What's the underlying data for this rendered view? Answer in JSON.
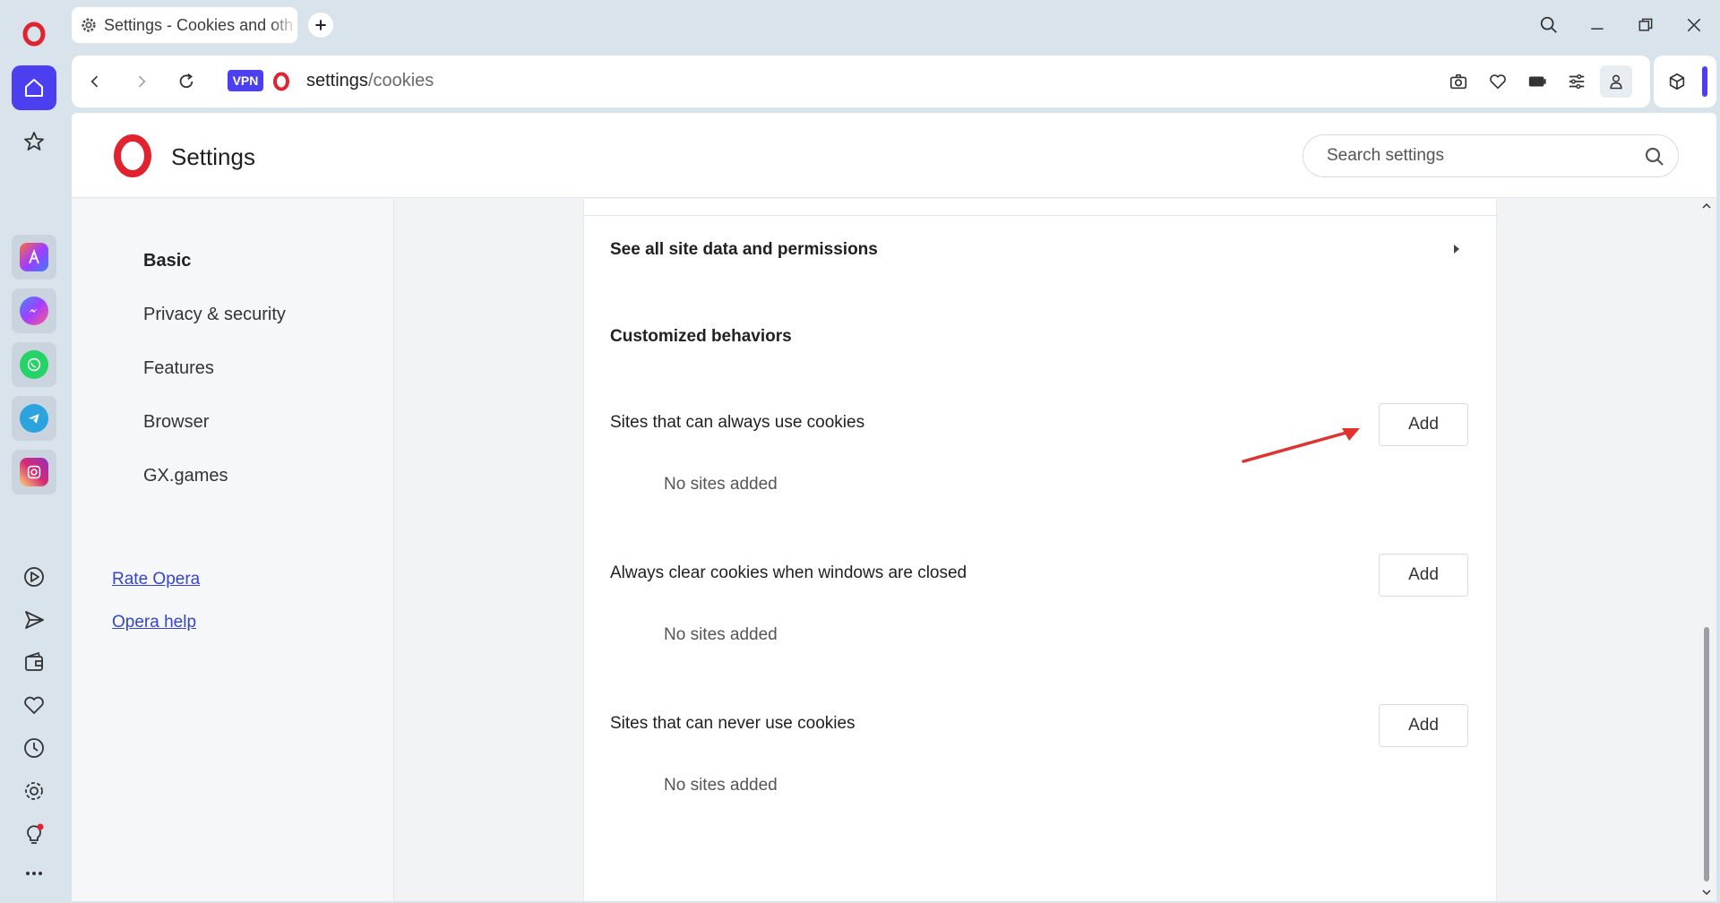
{
  "tab": {
    "title": "Settings - Cookies and other site data"
  },
  "address": {
    "vpn_label": "VPN",
    "url_host": "settings",
    "url_path": "/cookies"
  },
  "header": {
    "title": "Settings",
    "search_placeholder": "Search settings"
  },
  "nav": {
    "items": [
      {
        "label": "Basic",
        "active": true
      },
      {
        "label": "Privacy & security"
      },
      {
        "label": "Features"
      },
      {
        "label": "Browser"
      },
      {
        "label": "GX.games"
      }
    ],
    "links": [
      {
        "label": "Rate Opera"
      },
      {
        "label": "Opera help"
      }
    ]
  },
  "main": {
    "see_all": "See all site data and permissions",
    "customized_heading": "Customized behaviors",
    "sections": [
      {
        "title": "Sites that can always use cookies",
        "button": "Add",
        "empty": "No sites added"
      },
      {
        "title": "Always clear cookies when windows are closed",
        "button": "Add",
        "empty": "No sites added"
      },
      {
        "title": "Sites that can never use cookies",
        "button": "Add",
        "empty": "No sites added"
      }
    ]
  },
  "colors": {
    "accent": "#4b3ff0",
    "opera_red": "#e0232e",
    "annotation_arrow": "#e0322e"
  },
  "icons": {
    "sidebar": [
      "opera-logo-icon",
      "home-icon",
      "star-icon",
      "aria-icon",
      "messenger-icon",
      "whatsapp-icon",
      "telegram-icon",
      "instagram-icon",
      "player-icon",
      "send-icon",
      "wallet-icon",
      "heart-icon",
      "history-icon",
      "gear-icon",
      "lightbulb-icon",
      "more-icon"
    ],
    "toolbar": [
      "camera-icon",
      "heart-icon",
      "battery-icon",
      "easy-setup-icon",
      "profile-icon",
      "cube-icon"
    ]
  }
}
